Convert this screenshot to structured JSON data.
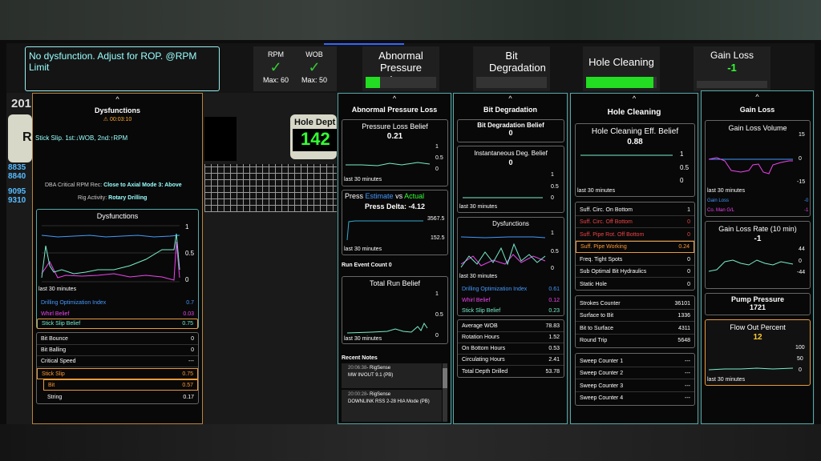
{
  "header": {
    "message": "No dysfunction. Adjust for ROP. @RPM Limit",
    "rpm": {
      "label": "RPM",
      "max": "Max: 60"
    },
    "wob": {
      "label": "WOB",
      "max": "Max: 50"
    },
    "tiles": [
      {
        "label": "Abnormal Pressure Loss",
        "fill": 0.2
      },
      {
        "label": "Bit Degradation",
        "fill": 0
      },
      {
        "label": "Hole Cleaning",
        "fill": 0.95
      },
      {
        "label": "Gain Loss",
        "value": "-1",
        "fill": 0
      }
    ]
  },
  "bg": {
    "year": "201",
    "depth_label": "Hole Dept",
    "depth": "142",
    "nums": [
      "8835",
      "8840",
      "9095",
      "9310"
    ],
    "r": "R"
  },
  "dys": {
    "caret": "^",
    "title": "Dysfunctions",
    "timer": "00:03:10",
    "stick": "Stick Slip. 1st:↓WOB, 2nd:↑RPM",
    "dba_label": "DBA Critical RPM Rec:",
    "dba_value": "Close to Axial Mode 3: Above",
    "rig_label": "Rig Activity:",
    "rig_value": "Rotary Drilling",
    "chart_title": "Dysfunctions",
    "ticks": [
      "1",
      "0.5",
      "0"
    ],
    "x": "last 30 minutes",
    "legend": [
      {
        "name": "Drilling Optimization Index",
        "value": "0.7"
      },
      {
        "name": "Whirl Belief",
        "value": "0.03"
      },
      {
        "name": "Stick Slip Belief",
        "value": "0.75"
      }
    ],
    "rows": [
      {
        "name": "Bit Bounce",
        "value": "0"
      },
      {
        "name": "Bit Balling",
        "value": "0"
      },
      {
        "name": "Critical Speed",
        "value": "---"
      },
      {
        "name": "Stick Slip",
        "value": "0.75"
      },
      {
        "name": "Bit",
        "value": "0.57"
      },
      {
        "name": "String",
        "value": "0.17"
      }
    ]
  },
  "apl": {
    "caret": "^",
    "title": "Abnormal Pressure Loss",
    "belief_title": "Pressure Loss Belief",
    "belief": "0.21",
    "ticks": [
      "1",
      "0.5",
      "0"
    ],
    "x": "last 30 minutes",
    "press": "Press",
    "est": "Estimate",
    "vs": "vs",
    "act": "Actual",
    "delta": "Press Delta: -4.12",
    "p_hi": "3567.5",
    "p_lo": "152.5",
    "x2": "last 30 minutes",
    "run_count": "Run Event Count 0",
    "trb_title": "Total Run Belief",
    "trb_ticks": [
      "1",
      "0.5",
      "0"
    ],
    "x3": "last 30 minutes",
    "notes_title": "Recent Notes",
    "notes": [
      {
        "time": "20:06:38",
        "who": "- RigSense",
        "text": "MW IN/OUT 9.1 (PB)"
      },
      {
        "time": "20:00:28",
        "who": "- RigSense",
        "text": "DOWNLINK RSS 2-28 HIA Mode (PB)"
      }
    ]
  },
  "bd": {
    "caret": "^",
    "title": "Bit Degradation",
    "belief_title": "Bit Degradation Belief",
    "belief": "0",
    "inst_title": "Instantaneous Deg. Belief",
    "inst": "0",
    "ticks": [
      "1",
      "0.5",
      "0"
    ],
    "x": "last 30 minutes",
    "dys_title": "Dysfunctions",
    "dys_ticks": [
      "1",
      "0.5",
      "0"
    ],
    "x2": "last 30 minutes",
    "legend": [
      {
        "name": "Drilling Optimization Index",
        "value": "0.61"
      },
      {
        "name": "Whirl Belief",
        "value": "0.12"
      },
      {
        "name": "Stick Slip Belief",
        "value": "0.23"
      }
    ],
    "rows": [
      {
        "name": "Average WOB",
        "value": "78.83"
      },
      {
        "name": "Rotation Hours",
        "value": "1.52"
      },
      {
        "name": "On Bottom Hours",
        "value": "0.53"
      },
      {
        "name": "Circulating Hours",
        "value": "2.41"
      },
      {
        "name": "Total Depth Drilled",
        "value": "53.78"
      }
    ]
  },
  "hc": {
    "caret": "^",
    "title": "Hole Cleaning",
    "belief_title": "Hole Cleaning Eff. Belief",
    "belief": "0.88",
    "ticks": [
      "1",
      "0.5",
      "0"
    ],
    "x": "last 30 minutes",
    "rows": [
      {
        "name": "Suff. Circ. On Bottom",
        "value": "1"
      },
      {
        "name": "Suff. Circ. Off Bottom",
        "value": "0"
      },
      {
        "name": "Suff. Pipe Rot. Off Bottom",
        "value": "0"
      },
      {
        "name": "Suff. Pipe Working",
        "value": "0.24"
      },
      {
        "name": "Freq. Tight Spots",
        "value": "0"
      },
      {
        "name": "Sub Optimal Bit Hydraulics",
        "value": "0"
      },
      {
        "name": "Static Hole",
        "value": "0"
      }
    ],
    "counters": [
      {
        "name": "Strokes Counter",
        "value": "36101"
      },
      {
        "name": "Surface to Bit",
        "value": "1336"
      },
      {
        "name": "Bit to Surface",
        "value": "4311"
      },
      {
        "name": "Round Trip",
        "value": "5648"
      }
    ],
    "sweeps": [
      {
        "name": "Sweep Counter 1",
        "value": "---"
      },
      {
        "name": "Sweep Counter 2",
        "value": "---"
      },
      {
        "name": "Sweep Counter 3",
        "value": "---"
      },
      {
        "name": "Sweep Counter 4",
        "value": "---"
      }
    ]
  },
  "gl": {
    "caret": "^",
    "title": "Gain Loss",
    "vol_title": "Gain Loss Volume",
    "vol_ticks": [
      "15",
      "0",
      "-15"
    ],
    "x": "last 30 minutes",
    "leg1": "Gain Loss",
    "leg1v": "-0",
    "leg2": "Co. Man G/L",
    "leg2v": "-1",
    "rate_title": "Gain Loss Rate (10 min)",
    "rate": "-1",
    "rate_ticks": [
      "44",
      "0",
      "-44"
    ],
    "pump_title": "Pump Pressure",
    "pump": "1721",
    "flow_title": "Flow Out Percent",
    "flow": "12",
    "flow_ticks": [
      "100",
      "50",
      "0"
    ],
    "x2": "last 30 minutes"
  }
}
